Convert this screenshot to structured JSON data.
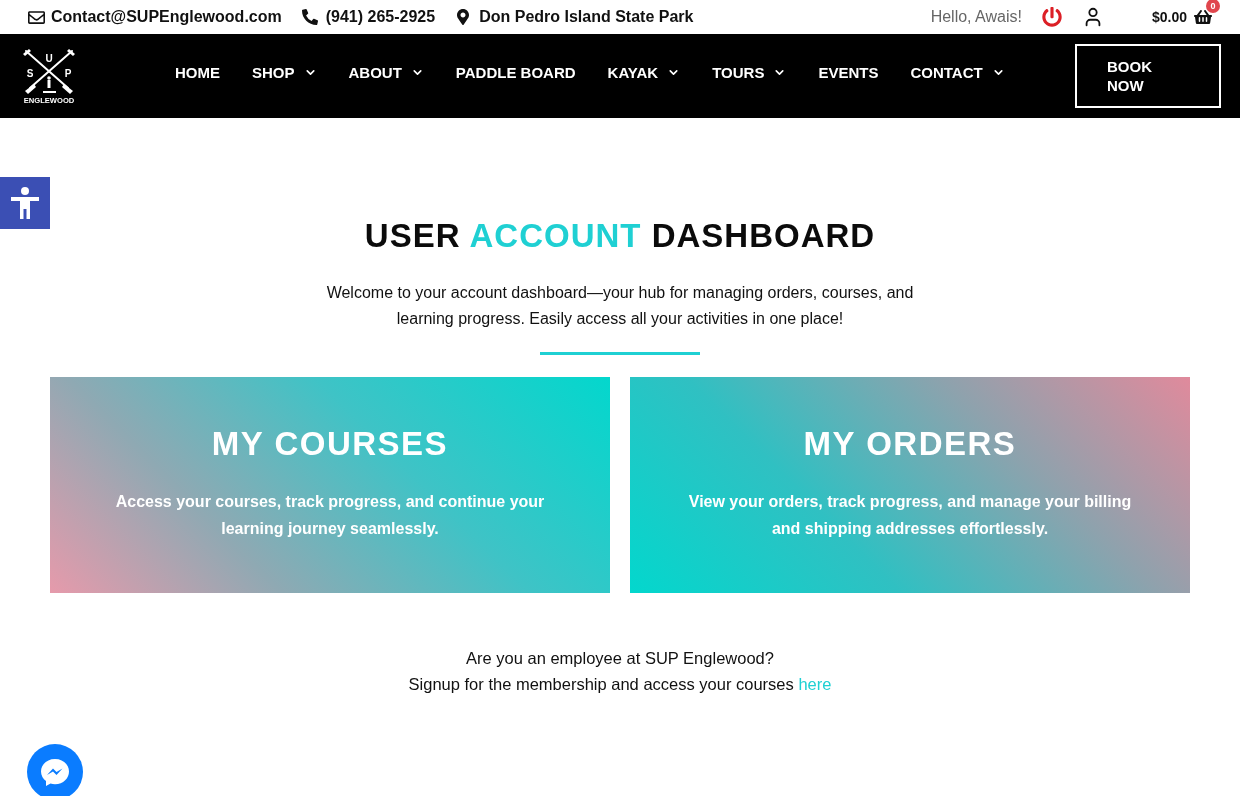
{
  "top_bar": {
    "email": "Contact@SUPEnglewood.com",
    "phone": "(941) 265-2925",
    "location": "Don Pedro Island State Park",
    "greeting": "Hello, Awais!",
    "cart_total": "$0.00",
    "cart_count": "0"
  },
  "logo": {
    "letters": [
      "S",
      "U",
      "P"
    ],
    "name": "ENGLEWOOD"
  },
  "nav": {
    "items": [
      {
        "label": "HOME",
        "has_submenu": false
      },
      {
        "label": "SHOP",
        "has_submenu": true
      },
      {
        "label": "ABOUT",
        "has_submenu": true
      },
      {
        "label": "PADDLE BOARD",
        "has_submenu": false
      },
      {
        "label": "KAYAK",
        "has_submenu": true
      },
      {
        "label": "TOURS",
        "has_submenu": true
      },
      {
        "label": "EVENTS",
        "has_submenu": false
      },
      {
        "label": "CONTACT",
        "has_submenu": true
      }
    ],
    "button": "BOOK NOW"
  },
  "hero": {
    "title": [
      {
        "text": "USER",
        "accent": false
      },
      {
        "text": "ACCOUNT",
        "accent": true
      },
      {
        "text": "DASHBOARD",
        "accent": false
      }
    ],
    "intro": "Welcome to your account dashboard—your hub for managing orders, courses, and learning progress. Easily access all your activities in one place!"
  },
  "cards": [
    {
      "title": "MY COURSES",
      "description": "Access your courses, track progress, and continue your learning journey seamlessly."
    },
    {
      "title": "MY ORDERS",
      "description": "View your orders, track progress, and manage your billing and shipping addresses effortlessly."
    }
  ],
  "footer_note": {
    "question": "Are you an employee at SUP Englewood?",
    "text": "Signup for the membership and access your courses",
    "link": "here"
  }
}
